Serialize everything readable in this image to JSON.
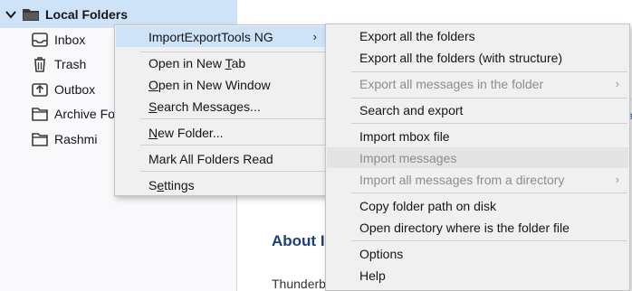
{
  "folder_pane": {
    "account_label": "Local Folders",
    "folders": [
      {
        "label": "Inbox",
        "icon": "inbox-icon"
      },
      {
        "label": "Trash",
        "icon": "trash-icon"
      },
      {
        "label": "Outbox",
        "icon": "outbox-icon"
      },
      {
        "label": "Archive Fo",
        "icon": "folder-icon"
      },
      {
        "label": "Rashmi",
        "icon": "folder-icon"
      }
    ]
  },
  "message_area": {
    "about_heading": "About I",
    "about_text": "Thunderbird is the leading open source, cross-platform email",
    "side_fragment_1": "ur",
    "side_fragment_2": "na"
  },
  "context_menu": {
    "items": [
      {
        "label": "ImportExportTools NG",
        "has_submenu": true,
        "highlighted": true
      },
      {
        "label_pre": "Open in New ",
        "mnemonic": "T",
        "label_post": "ab"
      },
      {
        "label_pre": "",
        "mnemonic": "O",
        "label_post": "pen in New Window"
      },
      {
        "label_pre": "",
        "mnemonic": "S",
        "label_post": "earch Messages..."
      },
      {
        "label_pre": "",
        "mnemonic": "N",
        "label_post": "ew Folder..."
      },
      {
        "label": "Mark All Folders Read"
      },
      {
        "label_pre": "S",
        "mnemonic": "e",
        "label_post": "ttings"
      }
    ],
    "arrow": "›"
  },
  "submenu": {
    "items": [
      {
        "label": "Export all the folders"
      },
      {
        "label": "Export all the folders (with structure)"
      },
      {
        "label": "Export all messages in the folder",
        "disabled": true,
        "has_submenu": true
      },
      {
        "label": "Search and export"
      },
      {
        "label": "Import mbox file"
      },
      {
        "label": "Import messages",
        "disabled": true
      },
      {
        "label": "Import all messages from a directory",
        "disabled": true,
        "has_submenu": true
      },
      {
        "label": "Copy folder path on disk"
      },
      {
        "label": "Open directory where is the folder file"
      },
      {
        "label": "Options"
      },
      {
        "label": "Help"
      }
    ]
  },
  "colors": {
    "selection": "#cfe3f8",
    "menu_bg": "#f0f0f0",
    "disabled_text": "#8c8c8c",
    "heading": "#1a3f7a"
  }
}
